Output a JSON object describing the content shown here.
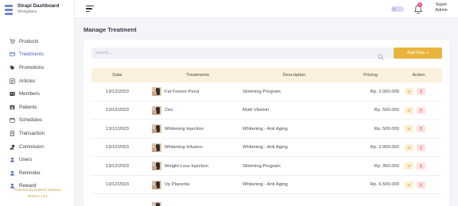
{
  "brand": {
    "title": "Strapi Dashboard",
    "subtitle": "Workplace"
  },
  "sidebar": {
    "items": [
      {
        "label": "Products",
        "icon": "cart-icon"
      },
      {
        "label": "Treatments",
        "icon": "card-icon"
      },
      {
        "label": "Promotions",
        "icon": "tag-icon"
      },
      {
        "label": "Articles",
        "icon": "article-icon"
      },
      {
        "label": "Members",
        "icon": "id-card-icon"
      },
      {
        "label": "Patients",
        "icon": "patient-icon"
      },
      {
        "label": "Schedules",
        "icon": "calendar-icon"
      },
      {
        "label": "Transaction",
        "icon": "receipt-icon"
      },
      {
        "label": "Commision",
        "icon": "commission-icon"
      },
      {
        "label": "Users",
        "icon": "user-icon"
      },
      {
        "label": "Reminder",
        "icon": "reminder-icon"
      },
      {
        "label": "Reward",
        "icon": "reward-icon"
      }
    ],
    "active_index": 1,
    "powered_by": "Powered by Eratech Solution",
    "version": "Version 1.01"
  },
  "topbar": {
    "user_line1": "Super",
    "user_line2": "Admin",
    "notification_count": "3"
  },
  "page": {
    "title": "Manage Treatment"
  },
  "search": {
    "placeholder": "Search..."
  },
  "add_button": {
    "label": "Add New +"
  },
  "table": {
    "headers": {
      "date": "Date",
      "treatments": "Treatments",
      "description": "Description",
      "pricing": "Pricing",
      "action": "Action"
    },
    "rows": [
      {
        "date": "13/12/2023",
        "treatment": "Fat Freeze Perut",
        "description": "Slimming Program",
        "price": "Rp. 2.000.000"
      },
      {
        "date": "13/12/2023",
        "treatment": "Zinc",
        "description": "Multi Vitamin",
        "price": "Rp. 500.000"
      },
      {
        "date": "13/12/2023",
        "treatment": "Whitening Injection",
        "description": "Whitening - Anti Aging",
        "price": "Rp. 500.000"
      },
      {
        "date": "13/12/2023",
        "treatment": "Whitening Infusion",
        "description": "Whitening - Anti Aging",
        "price": "Rp. 2.000.000"
      },
      {
        "date": "13/12/2023",
        "treatment": "Weight Loss Injection",
        "description": "Slimming Program",
        "price": "Rp. 350.000"
      },
      {
        "date": "13/12/2023",
        "treatment": "Vp Placenta",
        "description": "Whitening - Anti Aging",
        "price": "Rp. 6.500.000"
      }
    ]
  },
  "colors": {
    "accent": "#e8b43d",
    "active": "#4a5fc1",
    "header_bg": "#fbf1de",
    "badge": "#ea4c89"
  }
}
